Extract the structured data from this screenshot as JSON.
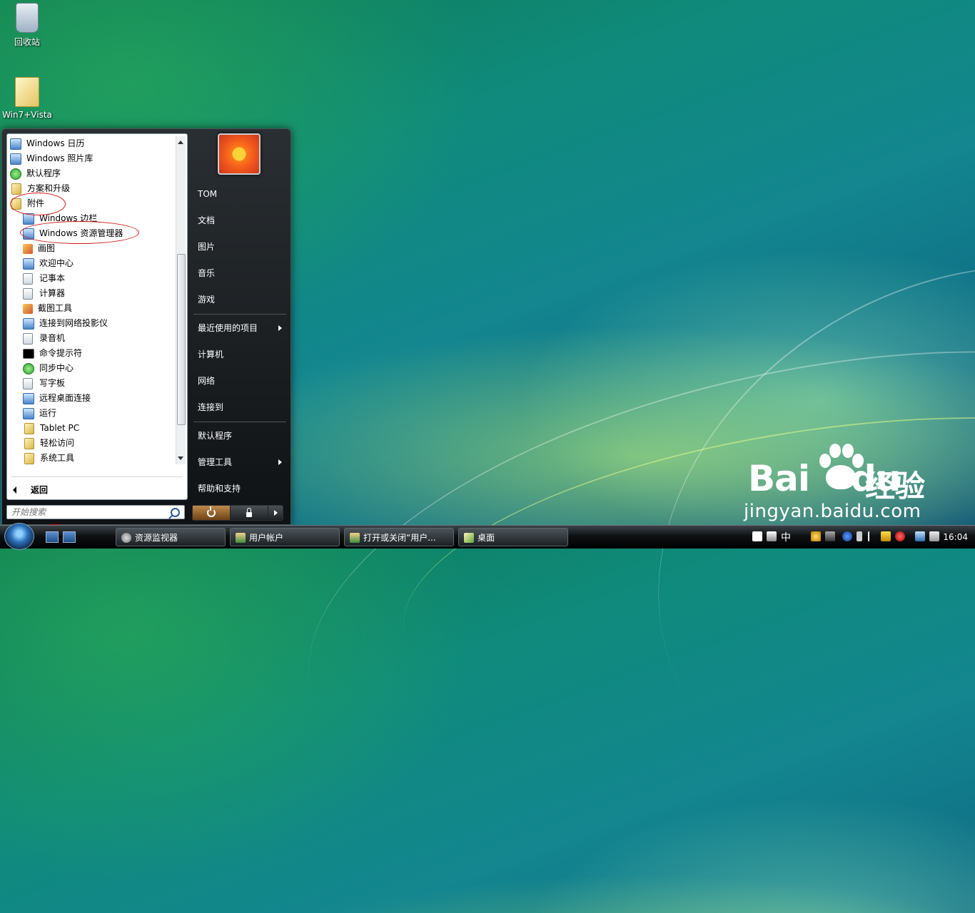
{
  "desktop": {
    "icons": [
      {
        "label": "回收站"
      },
      {
        "label": "Win7+Vista"
      }
    ]
  },
  "start_menu": {
    "programs": [
      {
        "label": "Windows 日历"
      },
      {
        "label": "Windows 照片库"
      },
      {
        "label": "默认程序"
      },
      {
        "label": "方案和升级"
      },
      {
        "label": "附件"
      },
      {
        "label": "Windows 边栏"
      },
      {
        "label": "Windows 资源管理器"
      },
      {
        "label": "画图"
      },
      {
        "label": "欢迎中心"
      },
      {
        "label": "记事本"
      },
      {
        "label": "计算器"
      },
      {
        "label": "截图工具"
      },
      {
        "label": "连接到网络投影仪"
      },
      {
        "label": "录音机"
      },
      {
        "label": "命令提示符"
      },
      {
        "label": "同步中心"
      },
      {
        "label": "写字板"
      },
      {
        "label": "远程桌面连接"
      },
      {
        "label": "运行"
      },
      {
        "label": "Tablet PC"
      },
      {
        "label": "轻松访问"
      },
      {
        "label": "系统工具"
      }
    ],
    "back_label": "返回",
    "search": {
      "placeholder": "开始搜索",
      "value": ""
    },
    "user_name": "TOM",
    "places": [
      {
        "label": "文档"
      },
      {
        "label": "图片"
      },
      {
        "label": "音乐"
      },
      {
        "label": "游戏"
      },
      {
        "label": "最近使用的项目"
      },
      {
        "label": "计算机"
      },
      {
        "label": "网络"
      },
      {
        "label": "连接到"
      },
      {
        "label": "默认程序"
      },
      {
        "label": "管理工具"
      },
      {
        "label": "帮助和支持"
      }
    ]
  },
  "taskbar": {
    "buttons": [
      {
        "label": "资源监视器"
      },
      {
        "label": "用户帐户"
      },
      {
        "label": "打开或关闭“用户..."
      },
      {
        "label": "桌面"
      }
    ],
    "tray": {
      "ime": "中",
      "clock": "16:04"
    }
  },
  "watermark": {
    "brand": "Bai",
    "brand_suffix": "du",
    "product": "经验",
    "domain": "jingyan.baidu.com"
  },
  "colors": {
    "annotation_ring": "#d01818",
    "menu_dark": "#0f1214",
    "desktop_teal": "#13868f"
  }
}
